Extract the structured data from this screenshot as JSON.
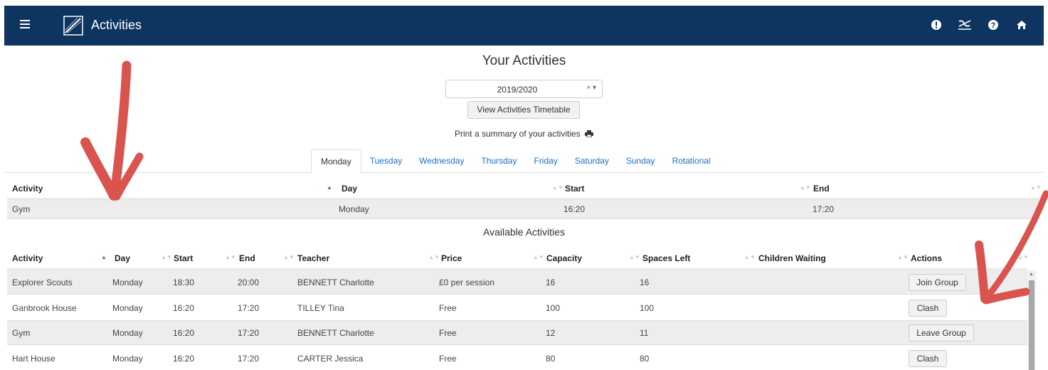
{
  "header": {
    "app_title": "Activities",
    "icons": [
      "alert-icon",
      "no-entry-icon",
      "help-icon",
      "home-icon"
    ]
  },
  "page": {
    "title": "Your Activities",
    "year_select": {
      "value": "2019/2020",
      "clear": "×",
      "caret": "▾"
    },
    "timetable_button": "View Activities Timetable",
    "print_text": "Print a summary of your activities"
  },
  "tabs": [
    "Monday",
    "Tuesday",
    "Wednesday",
    "Thursday",
    "Friday",
    "Saturday",
    "Sunday",
    "Rotational"
  ],
  "active_tab": "Monday",
  "your_activities": {
    "headers": [
      "Activity",
      "Day",
      "Start",
      "End"
    ],
    "rows": [
      {
        "activity": "Gym",
        "day": "Monday",
        "start": "16:20",
        "end": "17:20"
      }
    ]
  },
  "available": {
    "title": "Available Activities",
    "headers": [
      "Activity",
      "Day",
      "Start",
      "End",
      "Teacher",
      "Price",
      "Capacity",
      "Spaces Left",
      "Children Waiting",
      "Actions"
    ],
    "rows": [
      {
        "activity": "Explorer Scouts",
        "day": "Monday",
        "start": "18:30",
        "end": "20:00",
        "teacher": "BENNETT Charlotte",
        "price": "£0 per session",
        "capacity": "16",
        "spaces": "16",
        "waiting": "",
        "action": "Join Group"
      },
      {
        "activity": "Ganbrook House",
        "day": "Monday",
        "start": "16:20",
        "end": "17:20",
        "teacher": "TILLEY Tina",
        "price": "Free",
        "capacity": "100",
        "spaces": "100",
        "waiting": "",
        "action": "Clash"
      },
      {
        "activity": "Gym",
        "day": "Monday",
        "start": "16:20",
        "end": "17:20",
        "teacher": "BENNETT Charlotte",
        "price": "Free",
        "capacity": "12",
        "spaces": "11",
        "waiting": "",
        "action": "Leave Group"
      },
      {
        "activity": "Hart House",
        "day": "Monday",
        "start": "16:20",
        "end": "17:20",
        "teacher": "CARTER Jessica",
        "price": "Free",
        "capacity": "80",
        "spaces": "80",
        "waiting": "",
        "action": "Clash"
      }
    ]
  },
  "colors": {
    "topbar": "#0e3560",
    "link": "#1e6fc4",
    "arrow": "#d9534f"
  }
}
